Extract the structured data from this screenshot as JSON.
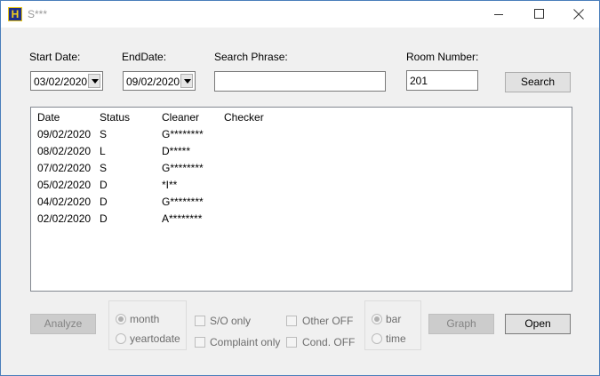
{
  "window": {
    "title": "S***",
    "icon_letter": "H",
    "icon_name": "app-logo-icon"
  },
  "filters": {
    "start_date_label": "Start Date:",
    "start_date_value": "03/02/2020",
    "end_date_label": "EndDate:",
    "end_date_value": "09/02/2020",
    "search_phrase_label": "Search Phrase:",
    "search_phrase_value": "",
    "room_number_label": "Room Number:",
    "room_number_value": "201",
    "search_button": "Search"
  },
  "list": {
    "columns": [
      "Date",
      "Status",
      "Cleaner",
      "Checker"
    ],
    "rows": [
      {
        "date": "09/02/2020",
        "status": "S",
        "cleaner": "G********",
        "checker": ""
      },
      {
        "date": "08/02/2020",
        "status": "L",
        "cleaner": "D*****",
        "checker": ""
      },
      {
        "date": "07/02/2020",
        "status": "S",
        "cleaner": "G********",
        "checker": ""
      },
      {
        "date": "05/02/2020",
        "status": "D",
        "cleaner": "*I**",
        "checker": ""
      },
      {
        "date": "04/02/2020",
        "status": "D",
        "cleaner": "G********",
        "checker": ""
      },
      {
        "date": "02/02/2020",
        "status": "D",
        "cleaner": "A********",
        "checker": ""
      }
    ]
  },
  "bottom": {
    "analyze_button": "Analyze",
    "period_options": [
      {
        "label": "month",
        "checked": true
      },
      {
        "label": "yeartodate",
        "checked": false
      }
    ],
    "checkboxes_left": [
      {
        "label": "S/O only",
        "checked": false
      },
      {
        "label": "Complaint only",
        "checked": false
      }
    ],
    "checkboxes_right": [
      {
        "label": "Other OFF",
        "checked": false
      },
      {
        "label": "Cond. OFF",
        "checked": false
      }
    ],
    "chart_options": [
      {
        "label": "bar",
        "checked": true
      },
      {
        "label": "time",
        "checked": false
      }
    ],
    "graph_button": "Graph",
    "open_button": "Open"
  }
}
